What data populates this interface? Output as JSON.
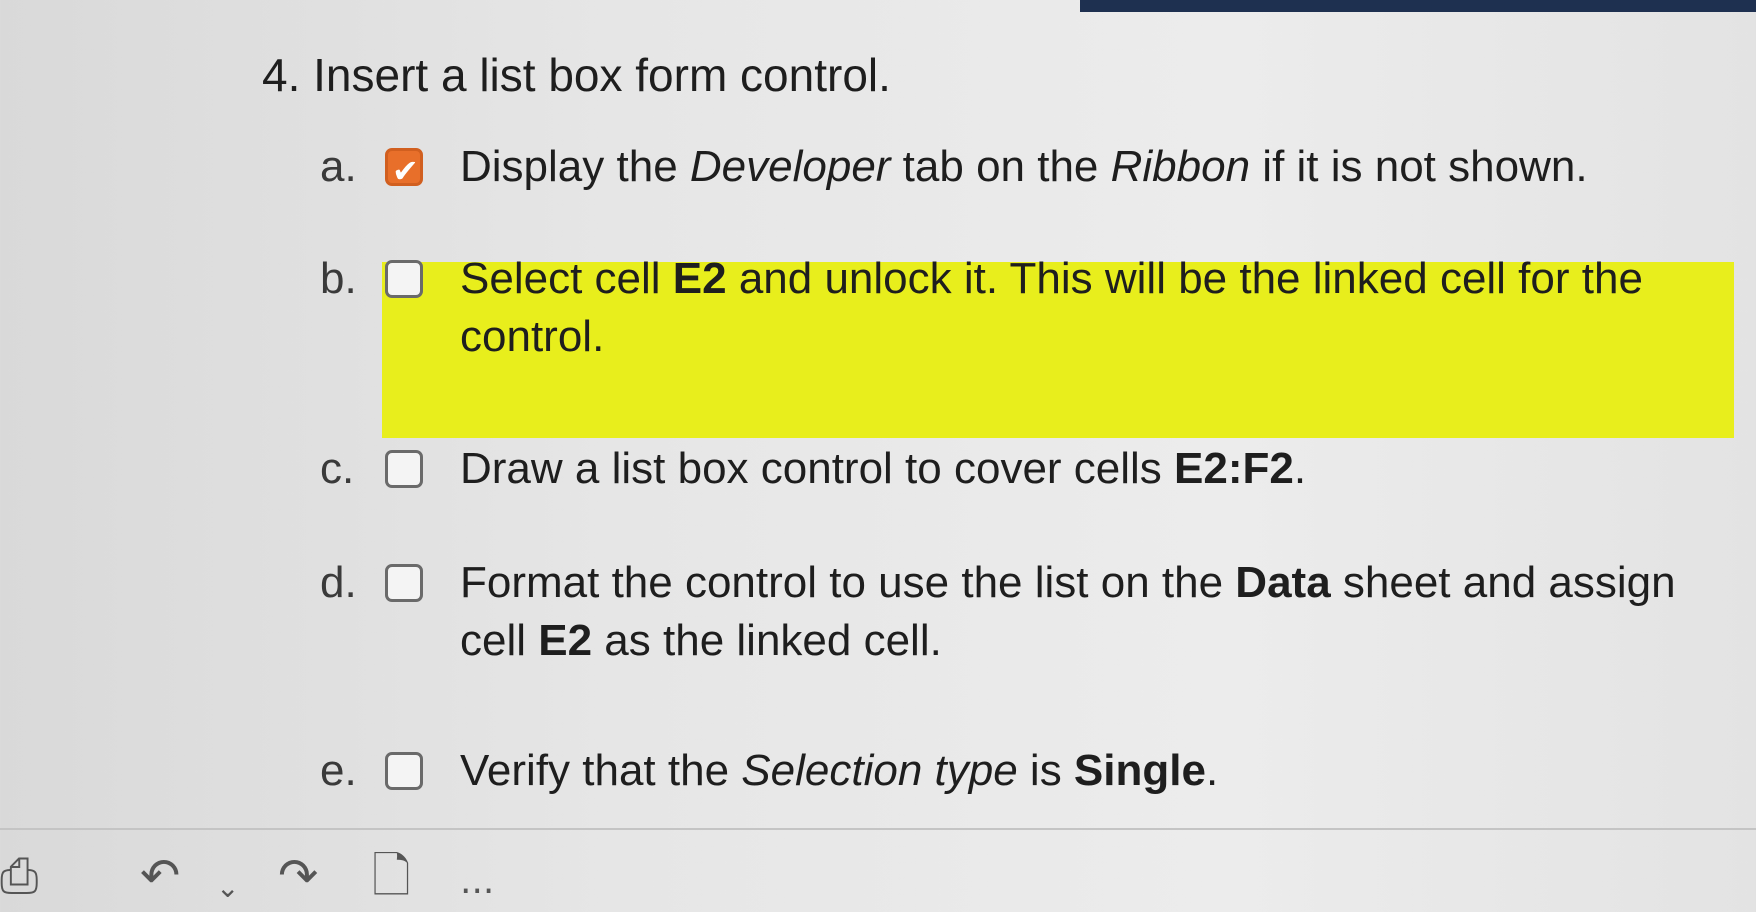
{
  "step": {
    "title": "4. Insert a list box form control."
  },
  "tasks": [
    {
      "letter": "a.",
      "checked": true,
      "segments": [
        {
          "text": "Display the ",
          "style": "normal"
        },
        {
          "text": "Developer",
          "style": "italic"
        },
        {
          "text": " tab on the ",
          "style": "normal"
        },
        {
          "text": "Ribbon",
          "style": "italic"
        },
        {
          "text": " if it is not shown.",
          "style": "normal"
        }
      ]
    },
    {
      "letter": "b.",
      "checked": false,
      "highlighted": true,
      "segments": [
        {
          "text": "Select cell ",
          "style": "normal"
        },
        {
          "text": "E2",
          "style": "bold"
        },
        {
          "text": " and unlock it. This will be the linked cell for the control.",
          "style": "normal"
        }
      ]
    },
    {
      "letter": "c.",
      "checked": false,
      "segments": [
        {
          "text": "Draw a list box control to cover cells ",
          "style": "normal"
        },
        {
          "text": "E2:F2",
          "style": "bold"
        },
        {
          "text": ".",
          "style": "normal"
        }
      ]
    },
    {
      "letter": "d.",
      "checked": false,
      "segments": [
        {
          "text": "Format the control to use the list on the ",
          "style": "normal"
        },
        {
          "text": "Data",
          "style": "bold"
        },
        {
          "text": " sheet and assign cell ",
          "style": "normal"
        },
        {
          "text": "E2",
          "style": "bold"
        },
        {
          "text": " as the linked cell.",
          "style": "normal"
        }
      ]
    },
    {
      "letter": "e.",
      "checked": false,
      "segments": [
        {
          "text": "Verify that the ",
          "style": "normal"
        },
        {
          "text": "Selection type",
          "style": "italic"
        },
        {
          "text": " is ",
          "style": "normal"
        },
        {
          "text": "Single",
          "style": "bold"
        },
        {
          "text": ".",
          "style": "normal"
        }
      ]
    }
  ],
  "toolbar": {
    "icons": [
      "print-icon",
      "undo-icon",
      "undo-dropdown-icon",
      "redo-icon",
      "new-document-icon",
      "more-options-icon"
    ],
    "more_label": "..."
  },
  "colors": {
    "highlight": "#e8ee1c",
    "checked": "#e86f2a",
    "top_bar": "#1e3050"
  }
}
